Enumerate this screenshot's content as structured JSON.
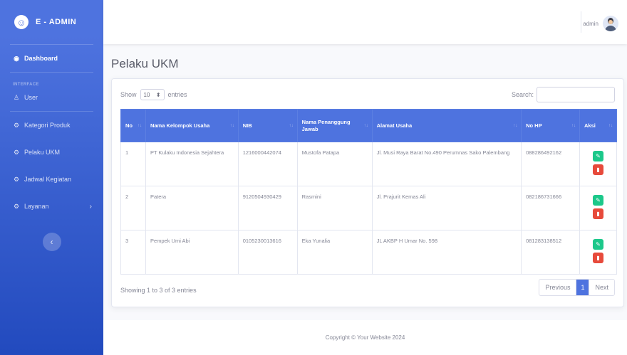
{
  "brand": {
    "name": "E - ADMIN",
    "logo_glyph": "☺"
  },
  "sidebar": {
    "dashboard": "Dashboard",
    "heading": "INTERFACE",
    "items": [
      {
        "label": "User",
        "icon": "user-icon"
      },
      {
        "label": "Kategori Produk",
        "icon": "cog-icon"
      },
      {
        "label": "Pelaku UKM",
        "icon": "cog-icon"
      },
      {
        "label": "Jadwal Kegiatan",
        "icon": "cog-icon"
      },
      {
        "label": "Layanan",
        "icon": "cog-icon"
      }
    ],
    "toggle_icon": "‹"
  },
  "topbar": {
    "user_name": "admin"
  },
  "page": {
    "title": "Pelaku UKM"
  },
  "table_controls": {
    "show_label": "Show",
    "entries_value": "10",
    "entries_label": "entries",
    "search_label": "Search:"
  },
  "table": {
    "headers": [
      "No",
      "Nama Kelompok Usaha",
      "NIB",
      "Nama Penanggung Jawab",
      "Alamat Usaha",
      "No HP",
      "Aksi"
    ],
    "rows": [
      {
        "no": "1",
        "nama": "PT Kulaku Indonesia Sejahtera",
        "nib": "1216000442074",
        "pj": "Mustofa Patapa",
        "alamat": "Jl. Musi Raya Barat No.490 Perumnas Sako Palembang",
        "hp": "088286492162"
      },
      {
        "no": "2",
        "nama": "Patera",
        "nib": "9120504930429",
        "pj": "Rasmini",
        "alamat": "Jl. Prajurit Kemas Ali",
        "hp": "082186731666"
      },
      {
        "no": "3",
        "nama": "Pempek Umi Abi",
        "nib": "0105230013616",
        "pj": "Eka Yunalia",
        "alamat": "JL AKBP H Umar No. 598",
        "hp": "081283138512"
      }
    ]
  },
  "footer_info": "Showing 1 to 3 of 3 entries",
  "pagination": {
    "previous": "Previous",
    "current": "1",
    "next": "Next"
  },
  "copyright": "Copyright © Your Website 2024",
  "colors": {
    "primary": "#4e73df",
    "success": "#1cc88a",
    "danger": "#e74a3b"
  }
}
